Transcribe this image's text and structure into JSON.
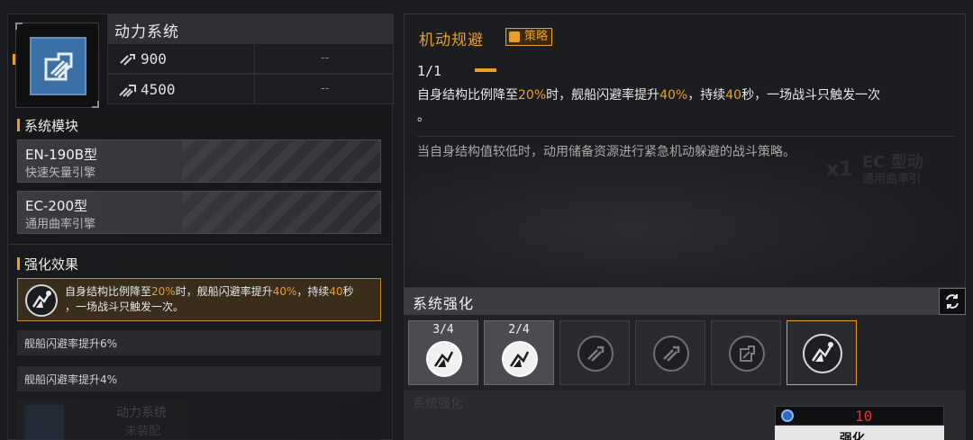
{
  "module": {
    "title": "动力系统",
    "icon": "thruster-module-icon",
    "stats": [
      {
        "icon": "speed-icon",
        "value": "900",
        "alt": "--"
      },
      {
        "icon": "boost-icon",
        "value": "4500",
        "alt": "--"
      }
    ]
  },
  "system_modules": {
    "header": "系统模块",
    "items": [
      {
        "name": "EN-190B型",
        "sub": "快速矢量引擎"
      },
      {
        "name": "EC-200型",
        "sub": "通用曲率引擎"
      }
    ]
  },
  "enhance_effects": {
    "header": "强化效果",
    "active": {
      "icon": "evasion-skill-icon",
      "parts": [
        "自身结构比例降至",
        "20%",
        "时，舰船闪避率提升",
        "40%",
        "，持续",
        "40",
        "秒",
        "，一场战斗只触发一次。"
      ]
    },
    "perks": [
      "舰船闪避率提升6%",
      "舰船闪避率提升4%"
    ],
    "faded": {
      "t1": "动力系统",
      "t2": "未装配"
    }
  },
  "skill": {
    "name": "机动规避",
    "tag": "策略",
    "counter": "1/1",
    "desc_parts": [
      "自身结构比例降至",
      "20%",
      "时，舰船闪避率提升",
      "40%",
      "，持续",
      "40",
      "秒，一场战斗只触发一次",
      "。"
    ],
    "flavor": "当自身结构值较低时，动用储备资源进行紧急机动躲避的战斗策略。",
    "ghost": [
      "x1",
      "EC 型动",
      "通用曲率引"
    ]
  },
  "system_enhance": {
    "title": "系统强化",
    "refresh_icon": "refresh-icon",
    "slots": [
      {
        "level": "3/4",
        "icon": "evasion-icon",
        "state": "active"
      },
      {
        "level": "2/4",
        "icon": "evasion-icon",
        "state": "active"
      },
      {
        "level": "",
        "icon": "thrust-icon",
        "state": "locked"
      },
      {
        "level": "",
        "icon": "thrust-icon",
        "state": "locked"
      },
      {
        "level": "",
        "icon": "boost-icon",
        "state": "locked"
      },
      {
        "level": "",
        "icon": "evasion-skill-icon",
        "state": "selected"
      }
    ],
    "bottom_label": "系统强化",
    "cost": {
      "icon": "crystal-icon",
      "value": "10"
    },
    "upgrade_label": "强化"
  },
  "colors": {
    "accent": "#e8a028",
    "panel": "#1c1d20",
    "module_blue": "#3b6fa8",
    "cost_red": "#e83030"
  }
}
